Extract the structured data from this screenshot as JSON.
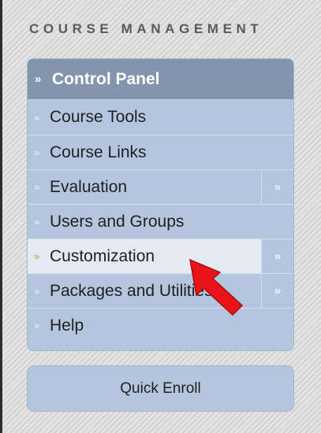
{
  "heading": "COURSE MANAGEMENT",
  "control_panel": {
    "title": "Control Panel",
    "header_icon": "double-chevron-up-icon",
    "items": [
      {
        "label": "Course Tools",
        "icon": "double-chevron-down-icon"
      },
      {
        "label": "Course Links",
        "icon": "double-chevron-down-icon"
      },
      {
        "label": "Evaluation",
        "icon": "double-chevron-down-icon",
        "expand_icon": "double-chevron-right-icon"
      },
      {
        "label": "Users and Groups",
        "icon": "double-chevron-down-icon"
      },
      {
        "label": "Customization",
        "icon": "double-chevron-down-icon",
        "expand_icon": "double-chevron-right-icon",
        "state": "hover"
      },
      {
        "label": "Packages and Utilities",
        "icon": "double-chevron-down-icon",
        "expand_icon": "double-chevron-right-icon"
      },
      {
        "label": "Help",
        "icon": "double-chevron-down-icon"
      }
    ]
  },
  "quick_enroll": "Quick Enroll",
  "colors": {
    "panel": "#b3c6de",
    "header": "#8395ad",
    "active_item": "#e4eaf2",
    "active_icon": "#c89a22",
    "pointer": "#e8141a"
  }
}
